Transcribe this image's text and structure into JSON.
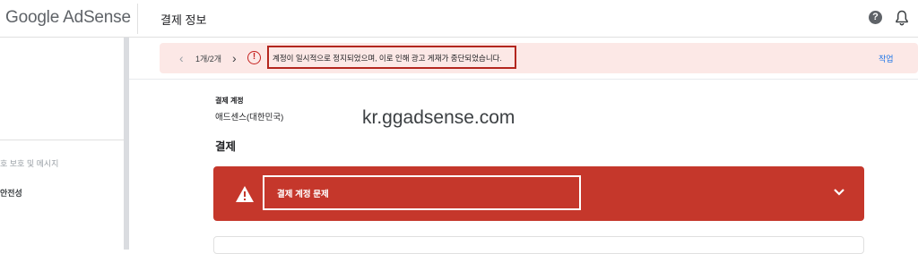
{
  "header": {
    "logo": "Google AdSense",
    "page_title": "결제 정보",
    "help_icon": "question-circle-icon",
    "notifications_icon": "bell-icon"
  },
  "sidebar": {
    "items": [
      {
        "label": "호 보호 및 메시지",
        "state": "disabled"
      },
      {
        "label": "안전성",
        "state": "active"
      }
    ]
  },
  "alert": {
    "pager": "1개/2개",
    "message": "계정이 일시적으로 정지되었으며, 이로 인해 광고 게재가 중단되었습니다.",
    "action": "작업",
    "icon": "error-circle-icon"
  },
  "billing": {
    "account_label": "결제 계정",
    "account_value": "애드센스(대한민국)",
    "section_title": "결제",
    "issue_title": "결제 계정 문제",
    "issue_icon": "warning-triangle-icon"
  },
  "watermark": "kr.ggadsense.com",
  "colors": {
    "alert_bg": "#fce8e6",
    "error_red": "#c5372b",
    "highlight_border": "#b3261e",
    "link_blue": "#1a73e8"
  }
}
